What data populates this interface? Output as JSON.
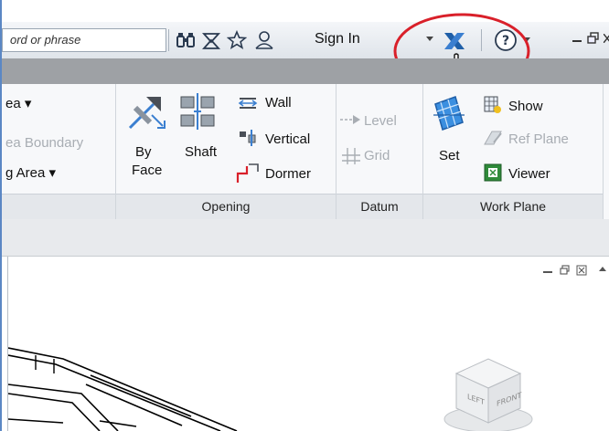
{
  "titlebar": {
    "search_placeholder": "ord or phrase",
    "sign_in": "Sign In"
  },
  "ribbon": {
    "area_items": [
      "ea ▾",
      "ea Boundary",
      "g  Area ▾"
    ],
    "opening": {
      "by_face": [
        "By",
        "Face"
      ],
      "shaft": "Shaft",
      "wall": "Wall",
      "vertical": "Vertical",
      "dormer": "Dormer",
      "title": "Opening"
    },
    "datum": {
      "level": "Level",
      "grid": "Grid",
      "title": "Datum"
    },
    "work_plane": {
      "set": "Set",
      "show": "Show",
      "ref_plane": "Ref Plane",
      "viewer": "Viewer",
      "title": "Work Plane"
    }
  },
  "viewcube": {
    "left": "LEFT",
    "front": "FRONT"
  },
  "colors": {
    "accent_blue": "#2c6fb5",
    "highlight_circle": "#d9202a",
    "gray_band": "#9ea1a5"
  }
}
